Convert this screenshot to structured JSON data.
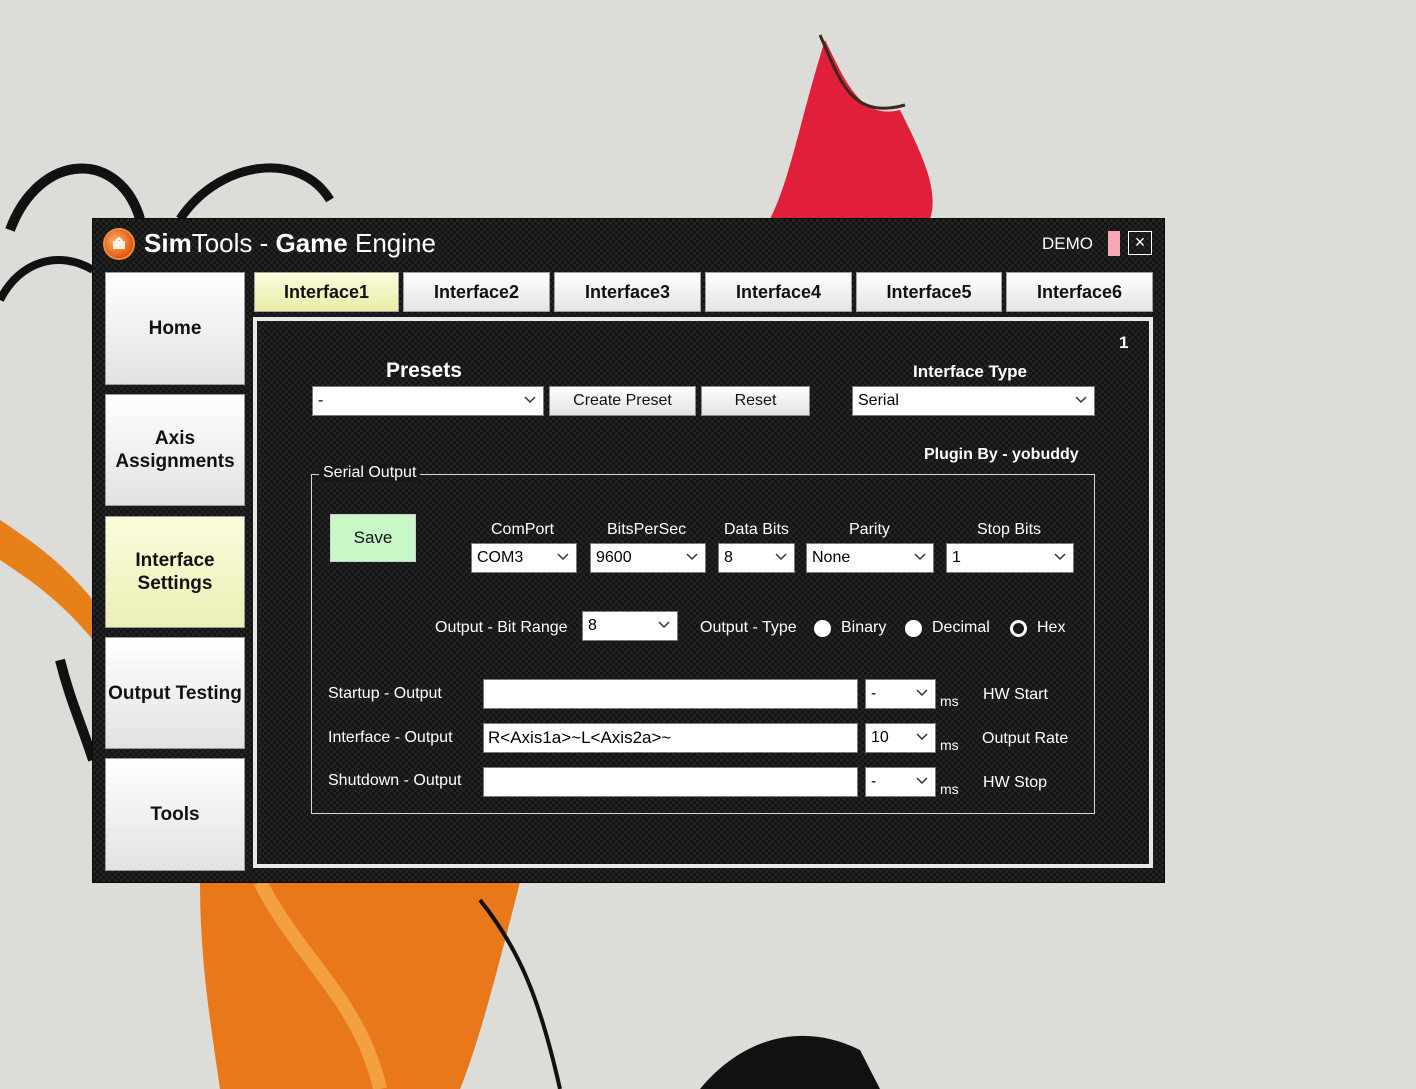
{
  "window": {
    "title_sim": "Sim",
    "title_tools": "Tools - ",
    "title_game": "Game",
    "title_engine": " Engine",
    "demo_label": "DEMO",
    "close_glyph": "×"
  },
  "sidebar": {
    "items": [
      {
        "label": "Home",
        "active": false
      },
      {
        "label": "Axis Assignments",
        "active": false
      },
      {
        "label": "Interface Settings",
        "active": true
      },
      {
        "label": "Output Testing",
        "active": false
      },
      {
        "label": "Tools",
        "active": false
      }
    ]
  },
  "tabs": [
    {
      "label": "Interface1",
      "active": true
    },
    {
      "label": "Interface2",
      "active": false
    },
    {
      "label": "Interface3",
      "active": false
    },
    {
      "label": "Interface4",
      "active": false
    },
    {
      "label": "Interface5",
      "active": false
    },
    {
      "label": "Interface6",
      "active": false
    }
  ],
  "panel": {
    "index_number": "1",
    "presets_label": "Presets",
    "presets_value": "-",
    "create_preset_label": "Create Preset",
    "reset_label": "Reset",
    "interface_type_label": "Interface Type",
    "interface_type_value": "Serial",
    "plugin_by": "Plugin By - yobuddy"
  },
  "serial_output": {
    "group_title": "Serial Output",
    "save_label": "Save",
    "comport_label": "ComPort",
    "comport_value": "COM3",
    "bits_per_sec_label": "BitsPerSec",
    "bits_per_sec_value": "9600",
    "data_bits_label": "Data Bits",
    "data_bits_value": "8",
    "parity_label": "Parity",
    "parity_value": "None",
    "stop_bits_label": "Stop Bits",
    "stop_bits_value": "1",
    "bit_range_label": "Output - Bit Range",
    "bit_range_value": "8",
    "output_type_label": "Output - Type",
    "output_type_options": [
      {
        "label": "Binary",
        "selected": false
      },
      {
        "label": "Decimal",
        "selected": false
      },
      {
        "label": "Hex",
        "selected": true
      }
    ],
    "startup_label": "Startup - Output",
    "startup_value": "",
    "startup_ms_value": "-",
    "hw_start_label": "HW Start",
    "interface_label": "Interface - Output",
    "interface_value": "R<Axis1a>~L<Axis2a>~",
    "interface_ms_value": "10",
    "output_rate_label": "Output Rate",
    "shutdown_label": "Shutdown - Output",
    "shutdown_value": "",
    "shutdown_ms_value": "-",
    "hw_stop_label": "HW Stop",
    "ms_unit": "ms"
  },
  "colors": {
    "accent_active": "#f4f6c8",
    "save_green": "#c8f7c8",
    "demo_pink": "#f7a8b4"
  },
  "icons": {
    "app": "simtools-logo-icon",
    "close": "close-icon",
    "dropdown": "chevron-down-icon"
  }
}
